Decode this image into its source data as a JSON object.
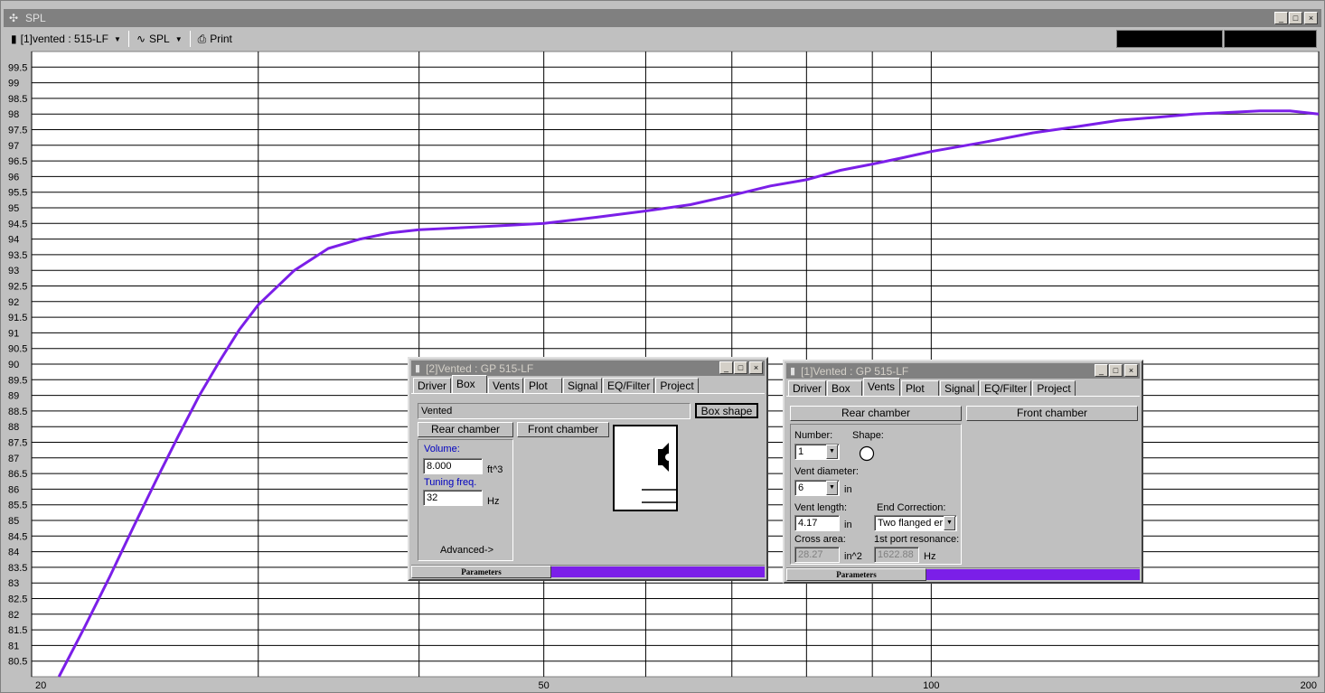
{
  "window": {
    "title": "SPL",
    "minimize": "_",
    "maximize": "□",
    "close": "×"
  },
  "toolbar": {
    "project_selector": "[1]vented : 515-LF",
    "plot_selector": "SPL",
    "print_label": "Print",
    "readout_left": "",
    "readout_right": ""
  },
  "icons": {
    "title": "move-icon",
    "project": "speaker-icon",
    "plot": "wave-icon",
    "print": "printer-icon",
    "dropdown": "chevron-down-icon"
  },
  "colors": {
    "curve": "#7b1fe8",
    "grid": "#000000",
    "plot_bg": "#ffffff",
    "window_bg": "#c0c0c0",
    "status_bar": "#7b1fe8"
  },
  "chart_data": {
    "type": "line",
    "title": "",
    "xlabel": "",
    "ylabel": "",
    "x_scale": "log",
    "xlim": [
      20,
      200
    ],
    "ylim": [
      80.0,
      100.0
    ],
    "x_ticks": [
      "20",
      "50",
      "100",
      "200"
    ],
    "y_ticks": [
      "99.5",
      "99",
      "98.5",
      "98",
      "97.5",
      "97",
      "96.5",
      "96",
      "95.5",
      "95",
      "94.5",
      "94",
      "93.5",
      "93",
      "92.5",
      "92",
      "91.5",
      "91",
      "90.5",
      "90",
      "89.5",
      "89",
      "88.5",
      "88",
      "87.5",
      "87",
      "86.5",
      "86",
      "85.5",
      "85",
      "84.5",
      "84",
      "83.5",
      "83",
      "82.5",
      "82",
      "81.5",
      "81",
      "80.5"
    ],
    "grid": true,
    "legend": "none",
    "series": [
      {
        "x": [
          21,
          22,
          23,
          24,
          25,
          26,
          27,
          28,
          29,
          30,
          32,
          34,
          36,
          38,
          40,
          45,
          50,
          55,
          60,
          65,
          70,
          75,
          80,
          85,
          90,
          95,
          100,
          110,
          120,
          130,
          140,
          150,
          160,
          170,
          180,
          190,
          200
        ],
        "values": [
          80.0,
          81.6,
          83.2,
          84.8,
          86.3,
          87.7,
          89.0,
          90.1,
          91.1,
          91.9,
          93.0,
          93.7,
          94.0,
          94.2,
          94.3,
          94.4,
          94.5,
          94.7,
          94.9,
          95.1,
          95.4,
          95.7,
          95.9,
          96.2,
          96.4,
          96.6,
          96.8,
          97.1,
          97.4,
          97.6,
          97.8,
          97.9,
          98.0,
          98.05,
          98.1,
          98.1,
          98.0
        ]
      }
    ]
  },
  "dialog1": {
    "title": "[2]Vented : GP 515-LF",
    "tabs": [
      "Driver",
      "Box",
      "Vents",
      "Plot",
      "Signal",
      "EQ/Filter",
      "Project"
    ],
    "active_tab": "Box",
    "box_type": "Vented",
    "box_shape_button": "Box shape",
    "rear_chamber_button": "Rear chamber",
    "front_chamber_button": "Front chamber",
    "volume_label": "Volume:",
    "volume_value": "8.000",
    "volume_unit": "ft^3",
    "tuning_label": "Tuning freq.",
    "tuning_value": "32",
    "tuning_unit": "Hz",
    "advanced_label": "Advanced->",
    "status_label": "Parameters"
  },
  "dialog2": {
    "title": "[1]Vented : GP 515-LF",
    "tabs": [
      "Driver",
      "Box",
      "Vents",
      "Plot",
      "Signal",
      "EQ/Filter",
      "Project"
    ],
    "active_tab": "Vents",
    "rear_chamber_button": "Rear chamber",
    "front_chamber_button": "Front chamber",
    "number_label": "Number:",
    "number_value": "1",
    "shape_label": "Shape:",
    "diameter_label": "Vent diameter:",
    "diameter_value": "6",
    "diameter_unit": "in",
    "length_label": "Vent length:",
    "length_value": "4.17",
    "length_unit": "in",
    "end_correction_label": "End Correction:",
    "end_correction_value": "Two flanged er",
    "cross_area_label": "Cross area:",
    "cross_area_value": "28.27",
    "cross_area_unit": "in^2",
    "port_resonance_label": "1st port resonance:",
    "port_resonance_value": "1622.88",
    "port_resonance_unit": "Hz",
    "status_label": "Parameters"
  }
}
